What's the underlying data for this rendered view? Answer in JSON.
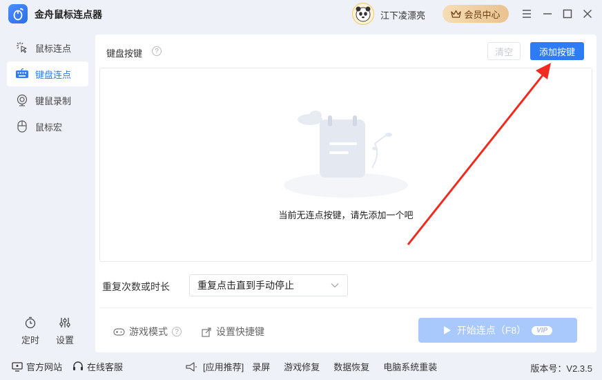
{
  "app": {
    "title": "金舟鼠标连点器",
    "user_name": "江下凌漂亮",
    "vip_label": "会员中心"
  },
  "sidebar": {
    "items": [
      {
        "label": "鼠标连点",
        "icon": "mouse-click-icon"
      },
      {
        "label": "键盘连点",
        "icon": "keyboard-icon"
      },
      {
        "label": "键鼠录制",
        "icon": "record-icon"
      },
      {
        "label": "鼠标宏",
        "icon": "mouse-icon"
      }
    ],
    "tools": [
      {
        "label": "定时",
        "icon": "timer-icon"
      },
      {
        "label": "设置",
        "icon": "settings-icon"
      }
    ]
  },
  "main": {
    "title": "键盘按键",
    "clear_label": "清空",
    "add_label": "添加按键",
    "empty_text": "当前无连点按键，请先添加一个吧",
    "repeat_label": "重复次数或时长",
    "repeat_value": "重复点击直到手动停止",
    "game_mode_label": "游戏模式",
    "hotkey_label": "设置快捷键",
    "start_label": "开始连点（F8）",
    "start_vip": "VIP"
  },
  "statusbar": {
    "website": "官方网站",
    "support": "在线客服",
    "recommend": "[应用推荐]",
    "links": [
      "录屏",
      "游戏修复",
      "数据恢复",
      "电脑系统重装"
    ],
    "version": "版本号：V2.3.5"
  },
  "colors": {
    "accent": "#2e7bf6",
    "annotation_arrow": "#f02a1e"
  }
}
